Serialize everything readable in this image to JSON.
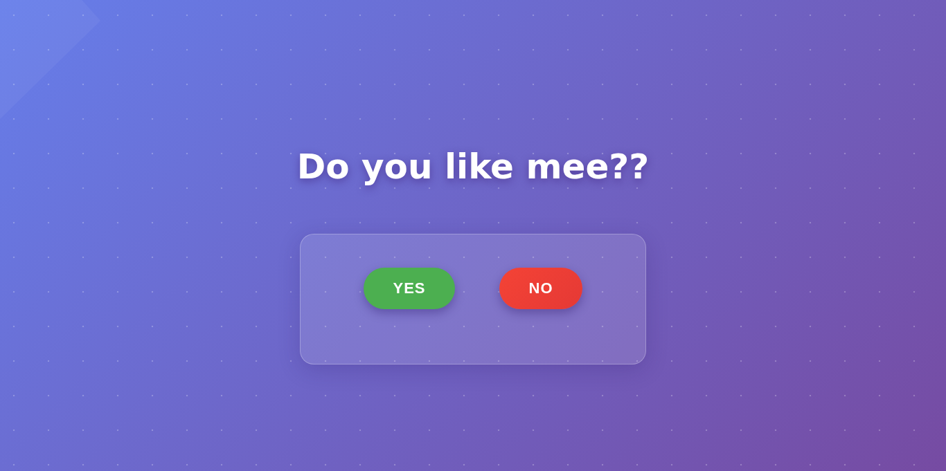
{
  "title": "Do you like mee??",
  "buttons": [
    {
      "label": "YES",
      "kind": "yes"
    },
    {
      "label": "NO",
      "kind": "no"
    }
  ]
}
